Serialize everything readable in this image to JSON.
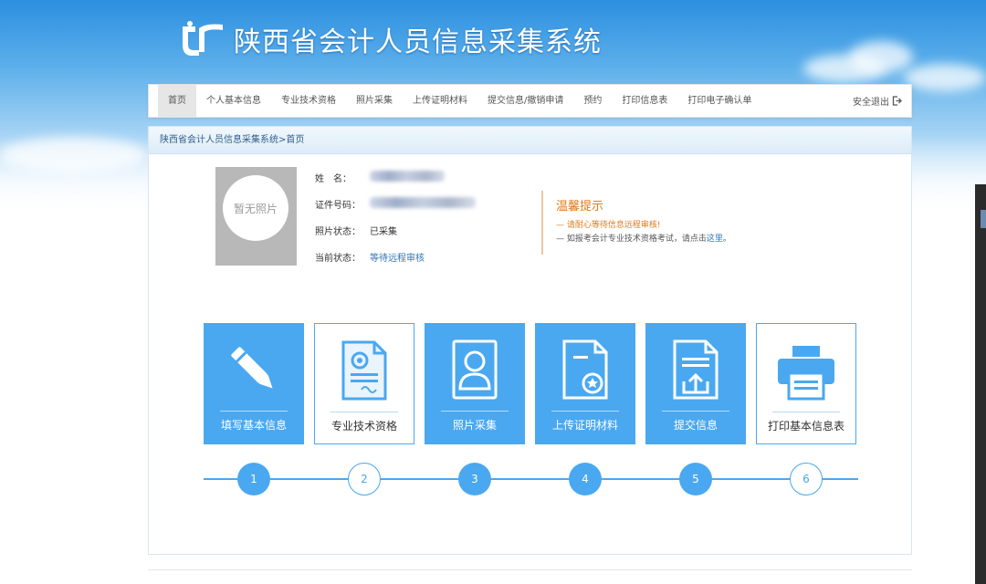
{
  "header": {
    "system_title": "陕西省会计人员信息采集系统"
  },
  "nav": {
    "items": [
      "首页",
      "个人基本信息",
      "专业技术资格",
      "照片采集",
      "上传证明材料",
      "提交信息/撤销申请",
      "预约",
      "打印信息表",
      "打印电子确认单"
    ],
    "logout": "安全退出"
  },
  "breadcrumb": "陕西省会计人员信息采集系统>首页",
  "profile": {
    "photo_placeholder": "暂无照片",
    "name_label": "姓　名：",
    "id_label": "证件号码：",
    "photo_status_label": "照片状态：",
    "photo_status": "已采集",
    "current_status_label": "当前状态：",
    "current_status": "等待远程审核"
  },
  "tips": {
    "title": "温馨提示",
    "line1": "— 请耐心等待信息远程审核!",
    "line2_prefix": "— 如报考会计专业技术资格考试，请点击",
    "line2_link": "这里",
    "line2_suffix": "。"
  },
  "cards": [
    {
      "label": "填写基本信息",
      "icon": "pencil-icon",
      "style": "filled"
    },
    {
      "label": "专业技术资格",
      "icon": "certificate-icon",
      "style": "outline"
    },
    {
      "label": "照片采集",
      "icon": "portrait-icon",
      "style": "filled"
    },
    {
      "label": "上传证明材料",
      "icon": "document-stamp-icon",
      "style": "filled"
    },
    {
      "label": "提交信息",
      "icon": "upload-document-icon",
      "style": "filled"
    },
    {
      "label": "打印基本信息表",
      "icon": "printer-icon",
      "style": "outline"
    }
  ],
  "steps": [
    {
      "number": "1",
      "style": "filled"
    },
    {
      "number": "2",
      "style": "outline"
    },
    {
      "number": "3",
      "style": "filled"
    },
    {
      "number": "4",
      "style": "filled"
    },
    {
      "number": "5",
      "style": "filled"
    },
    {
      "number": "6",
      "style": "outline"
    }
  ],
  "colors": {
    "primary": "#4aa8f0",
    "tip_orange": "#e07b1a",
    "link": "#2e74b5"
  }
}
